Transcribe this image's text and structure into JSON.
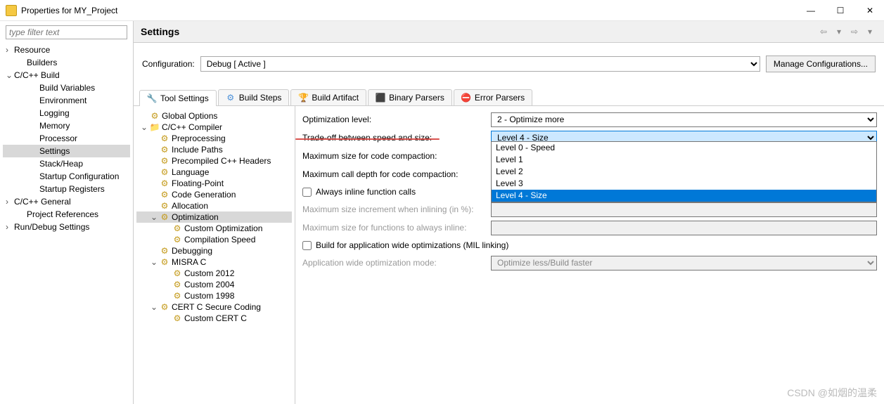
{
  "window": {
    "title": "Properties for MY_Project"
  },
  "filter_placeholder": "type filter text",
  "sidebar": {
    "items": [
      {
        "label": "Resource",
        "indent": 0,
        "caret": ">"
      },
      {
        "label": "Builders",
        "indent": 1,
        "caret": ""
      },
      {
        "label": "C/C++ Build",
        "indent": 0,
        "caret": "v"
      },
      {
        "label": "Build Variables",
        "indent": 2,
        "caret": ""
      },
      {
        "label": "Environment",
        "indent": 2,
        "caret": ""
      },
      {
        "label": "Logging",
        "indent": 2,
        "caret": ""
      },
      {
        "label": "Memory",
        "indent": 2,
        "caret": ""
      },
      {
        "label": "Processor",
        "indent": 2,
        "caret": ""
      },
      {
        "label": "Settings",
        "indent": 2,
        "caret": "",
        "selected": true
      },
      {
        "label": "Stack/Heap",
        "indent": 2,
        "caret": ""
      },
      {
        "label": "Startup Configuration",
        "indent": 2,
        "caret": ""
      },
      {
        "label": "Startup Registers",
        "indent": 2,
        "caret": ""
      },
      {
        "label": "C/C++ General",
        "indent": 0,
        "caret": ">"
      },
      {
        "label": "Project References",
        "indent": 1,
        "caret": ""
      },
      {
        "label": "Run/Debug Settings",
        "indent": 0,
        "caret": ">"
      }
    ]
  },
  "content": {
    "heading": "Settings",
    "config_label": "Configuration:",
    "config_value": "Debug  [ Active ]",
    "manage_btn": "Manage Configurations..."
  },
  "tabs": [
    {
      "label": "Tool Settings",
      "icon": "tool",
      "active": true
    },
    {
      "label": "Build Steps",
      "icon": "steps"
    },
    {
      "label": "Build Artifact",
      "icon": "artifact"
    },
    {
      "label": "Binary Parsers",
      "icon": "binary"
    },
    {
      "label": "Error Parsers",
      "icon": "error"
    }
  ],
  "tool_tree": [
    {
      "label": "Global Options",
      "i": 1,
      "icon": "gear",
      "caret": ""
    },
    {
      "label": "C/C++ Compiler",
      "i": 1,
      "icon": "folder",
      "caret": "v"
    },
    {
      "label": "Preprocessing",
      "i": 2,
      "icon": "gear",
      "caret": ""
    },
    {
      "label": "Include Paths",
      "i": 2,
      "icon": "gear",
      "caret": ""
    },
    {
      "label": "Precompiled C++ Headers",
      "i": 2,
      "icon": "gear",
      "caret": ""
    },
    {
      "label": "Language",
      "i": 2,
      "icon": "gear",
      "caret": ""
    },
    {
      "label": "Floating-Point",
      "i": 2,
      "icon": "gear",
      "caret": ""
    },
    {
      "label": "Code Generation",
      "i": 2,
      "icon": "gear",
      "caret": ""
    },
    {
      "label": "Allocation",
      "i": 2,
      "icon": "gear",
      "caret": ""
    },
    {
      "label": "Optimization",
      "i": 2,
      "icon": "gear",
      "caret": "v",
      "selected": true
    },
    {
      "label": "Custom Optimization",
      "i": 3,
      "icon": "gear",
      "caret": ""
    },
    {
      "label": "Compilation Speed",
      "i": 3,
      "icon": "gear",
      "caret": ""
    },
    {
      "label": "Debugging",
      "i": 2,
      "icon": "gear",
      "caret": ""
    },
    {
      "label": "MISRA C",
      "i": 2,
      "icon": "gear",
      "caret": "v"
    },
    {
      "label": "Custom 2012",
      "i": 3,
      "icon": "gear",
      "caret": ""
    },
    {
      "label": "Custom 2004",
      "i": 3,
      "icon": "gear",
      "caret": ""
    },
    {
      "label": "Custom 1998",
      "i": 3,
      "icon": "gear",
      "caret": ""
    },
    {
      "label": "CERT C Secure Coding",
      "i": 2,
      "icon": "gear",
      "caret": "v"
    },
    {
      "label": "Custom CERT C",
      "i": 3,
      "icon": "gear",
      "caret": ""
    }
  ],
  "form": {
    "opt_level_label": "Optimization level:",
    "opt_level_value": "2 - Optimize more",
    "tradeoff_label": "Trade-off between speed and size:",
    "tradeoff_value": "Level 4 - Size",
    "max_size_label": "Maximum size for code compaction:",
    "max_depth_label": "Maximum call depth for code compaction:",
    "always_inline": "Always inline function calls",
    "max_inline_incr": "Maximum size increment when inlining (in %):",
    "max_inline_fn": "Maximum size for functions to always inline:",
    "build_mil": "Build for application wide optimizations (MIL linking)",
    "app_mode_label": "Application wide optimization mode:",
    "app_mode_value": "Optimize less/Build faster"
  },
  "tradeoff_options": [
    "Level 0 - Speed",
    "Level 1",
    "Level 2",
    "Level 3",
    "Level 4 - Size"
  ],
  "watermark": "CSDN @如烟的温柔"
}
